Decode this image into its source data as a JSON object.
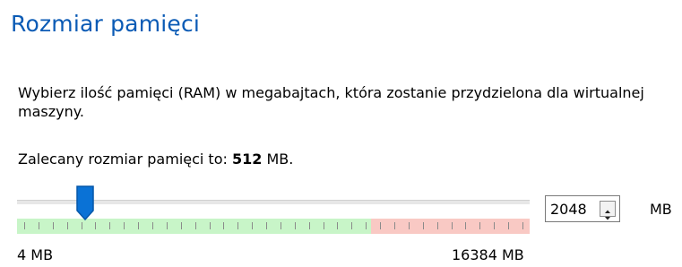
{
  "page": {
    "title": "Rozmiar pamięci",
    "description": "Wybierz ilość pamięci (RAM) w megabajtach, która zostanie przydzielona dla wirtualnej maszyny.",
    "recommended_prefix": "Zalecany rozmiar pamięci to: ",
    "recommended_value": "512",
    "recommended_unit": " MB."
  },
  "slider": {
    "min_label": "4 MB",
    "max_label": "16384 MB",
    "min_value": 4,
    "max_value": 16384,
    "current_value": 2048,
    "safe_limit_value": 12288,
    "accent_color": "#0a72d6",
    "safe_color": "#c8f5c8",
    "warning_color": "#f9c9c4"
  },
  "spinbox": {
    "value": "2048",
    "unit": "MB",
    "up_icon": "arrow-up-icon",
    "down_icon": "arrow-down-icon"
  }
}
